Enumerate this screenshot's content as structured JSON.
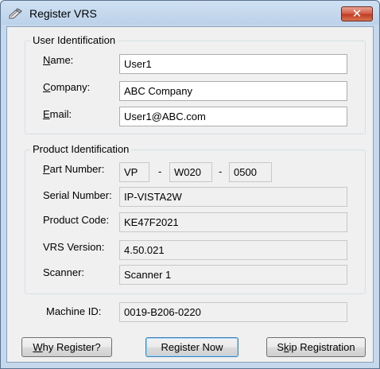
{
  "window": {
    "title": "Register VRS",
    "close_label": "✕"
  },
  "user_identification": {
    "title": "User Identification",
    "name": {
      "label_first": "N",
      "label_rest": "ame:",
      "value": "User1"
    },
    "company": {
      "label_first": "C",
      "label_rest": "ompany:",
      "value": "ABC Company"
    },
    "email": {
      "label_first": "E",
      "label_rest": "mail:",
      "value": "User1@ABC.com"
    }
  },
  "product_identification": {
    "title": "Product Identification",
    "part_number": {
      "label_first": "P",
      "label_rest": "art Number:",
      "part1": "VP",
      "part2": "W020",
      "part3": "0500",
      "separator": "-"
    },
    "serial_number": {
      "label": "Serial Number:",
      "value": "IP-VISTA2W"
    },
    "product_code": {
      "label": "Product Code:",
      "value": "KE47F2021"
    },
    "vrs_version": {
      "label": "VRS Version:",
      "value": "4.50.021"
    },
    "scanner": {
      "label": "Scanner:",
      "value": "Scanner 1"
    }
  },
  "machine_id": {
    "label": "Machine ID:",
    "value": "0019-B206-0220"
  },
  "buttons": {
    "why_register": {
      "first": "W",
      "rest": "hy Register?"
    },
    "register_now": "Register Now",
    "skip_registration": {
      "pre": "S",
      "mnemonic": "k",
      "rest": "ip Registration"
    }
  },
  "colors": {
    "title_bar": "#c6d8ec",
    "close_button": "#c03d24",
    "dialog_bg": "#f0f0f0"
  },
  "icons": {
    "app": "pencil-icon",
    "close": "close-icon"
  }
}
